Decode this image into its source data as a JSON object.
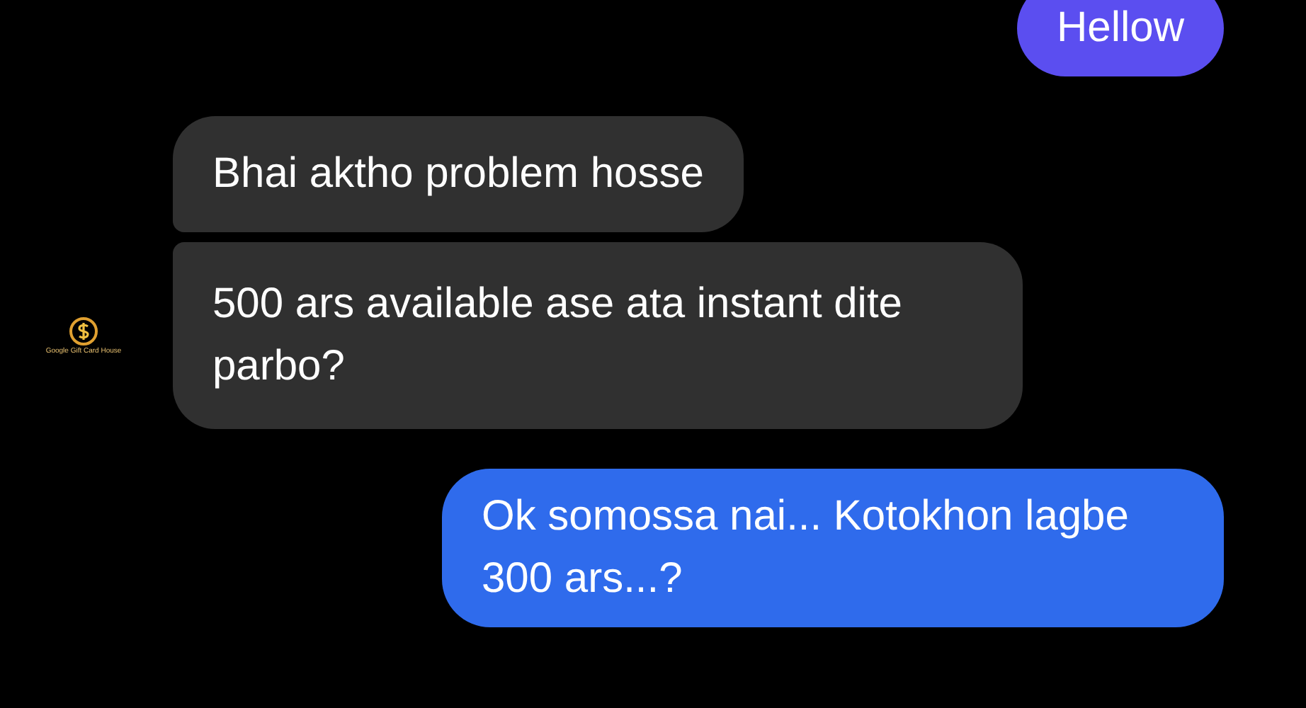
{
  "messages": [
    {
      "kind": "sent",
      "text": "Hellow",
      "color": "#5b4ef0"
    },
    {
      "kind": "received",
      "text": "Bhai aktho problem hosse"
    },
    {
      "kind": "received",
      "text": "500 ars available ase ata instant dite parbo?",
      "avatar": "Google Gift Card House"
    },
    {
      "kind": "sent",
      "text": "Ok somossa nai... Kotokhon lagbe 300 ars...?",
      "color": "#2f6bec"
    }
  ]
}
